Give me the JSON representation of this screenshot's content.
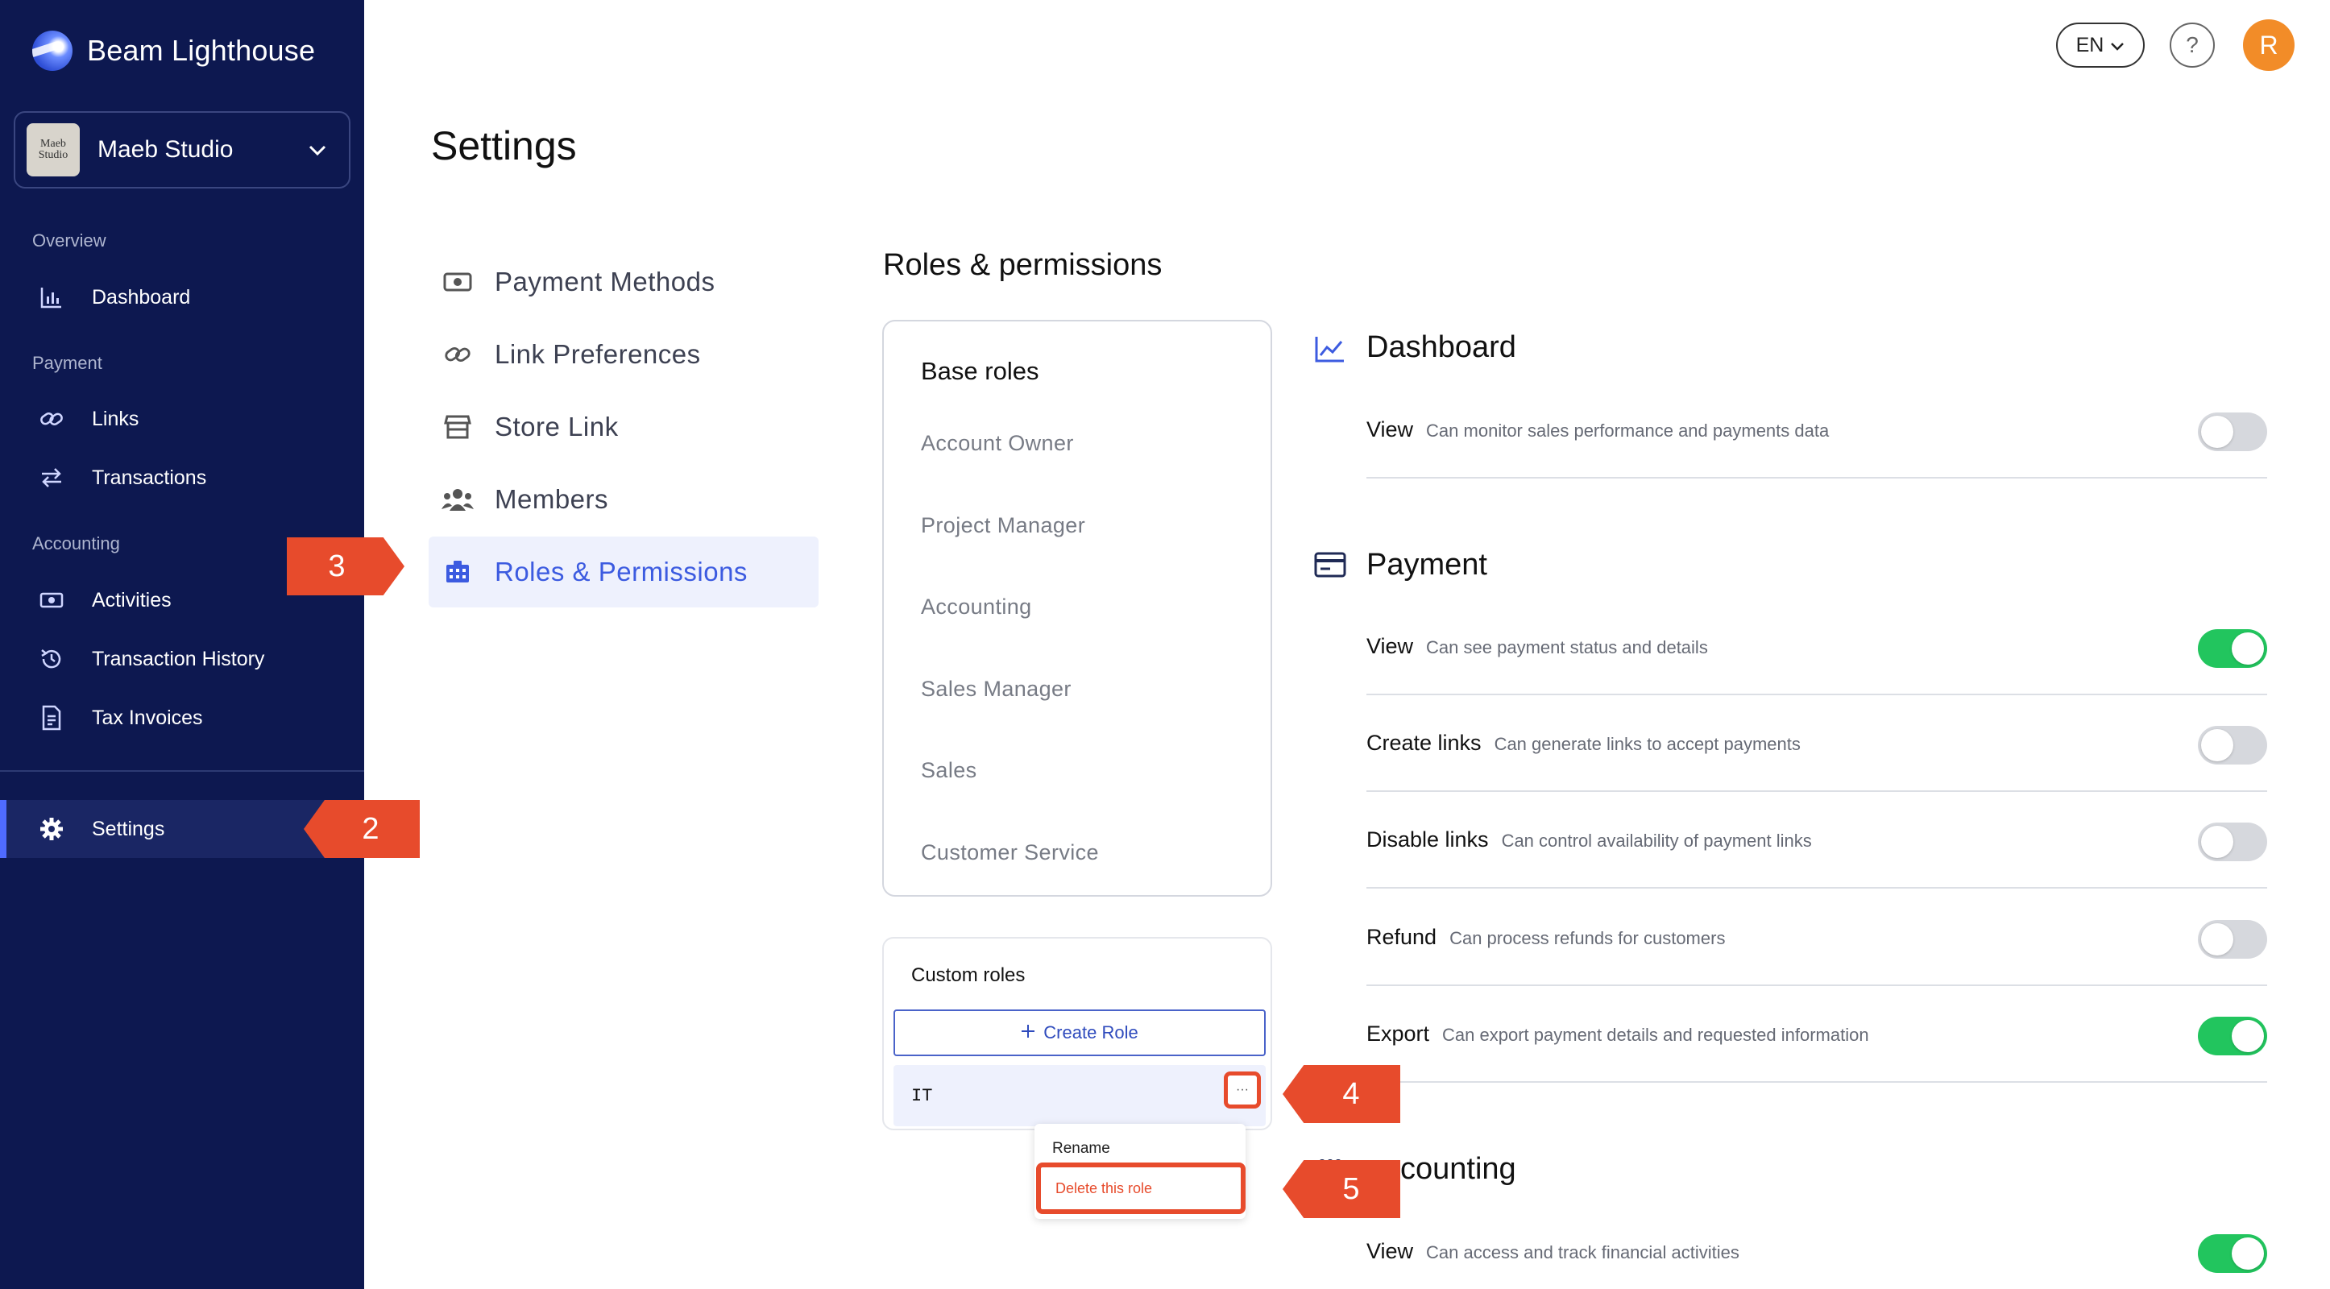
{
  "brand": {
    "name": "Beam Lighthouse"
  },
  "org": {
    "name": "Maeb Studio",
    "avatar_text": "Maeb Studio"
  },
  "nav": {
    "overview_label": "Overview",
    "dashboard": "Dashboard",
    "payment_label": "Payment",
    "links": "Links",
    "transactions": "Transactions",
    "accounting_label": "Accounting",
    "activities": "Activities",
    "transaction_history": "Transaction History",
    "tax_invoices": "Tax Invoices",
    "settings": "Settings"
  },
  "header": {
    "lang": "EN",
    "help": "?",
    "user_initial": "R"
  },
  "page": {
    "title": "Settings"
  },
  "settings_menu": {
    "payment_methods": "Payment Methods",
    "link_preferences": "Link Preferences",
    "store_link": "Store Link",
    "members": "Members",
    "roles_permissions": "Roles & Permissions"
  },
  "roles": {
    "section_title": "Roles & permissions",
    "base_title": "Base roles",
    "base": [
      "Account Owner",
      "Project Manager",
      "Accounting",
      "Sales Manager",
      "Sales",
      "Customer Service"
    ],
    "custom_title": "Custom roles",
    "create_label": "Create Role",
    "custom": [
      "IT"
    ],
    "more": "···",
    "menu_rename": "Rename",
    "menu_delete": "Delete this role"
  },
  "callouts": {
    "c2": "2",
    "c3": "3",
    "c4": "4",
    "c5": "5"
  },
  "permissions": {
    "dashboard": {
      "title": "Dashboard",
      "items": [
        {
          "name": "View",
          "desc": "Can monitor sales performance and payments data",
          "enabled": false
        }
      ]
    },
    "payment": {
      "title": "Payment",
      "items": [
        {
          "name": "View",
          "desc": "Can see payment status and details",
          "enabled": true
        },
        {
          "name": "Create links",
          "desc": "Can generate links to accept payments",
          "enabled": false
        },
        {
          "name": "Disable links",
          "desc": "Can control availability of payment links",
          "enabled": false
        },
        {
          "name": "Refund",
          "desc": "Can process refunds for customers",
          "enabled": false
        },
        {
          "name": "Export",
          "desc": "Can export payment details and requested information",
          "enabled": true
        }
      ]
    },
    "accounting": {
      "title": "counting",
      "items": [
        {
          "name": "View",
          "desc": "Can access and track financial activities",
          "enabled": true
        }
      ]
    }
  },
  "colors": {
    "sidebar": "#0d1850",
    "accent": "#3c5be0",
    "callout": "#e74b2c",
    "toggle_on": "#22c55e"
  }
}
